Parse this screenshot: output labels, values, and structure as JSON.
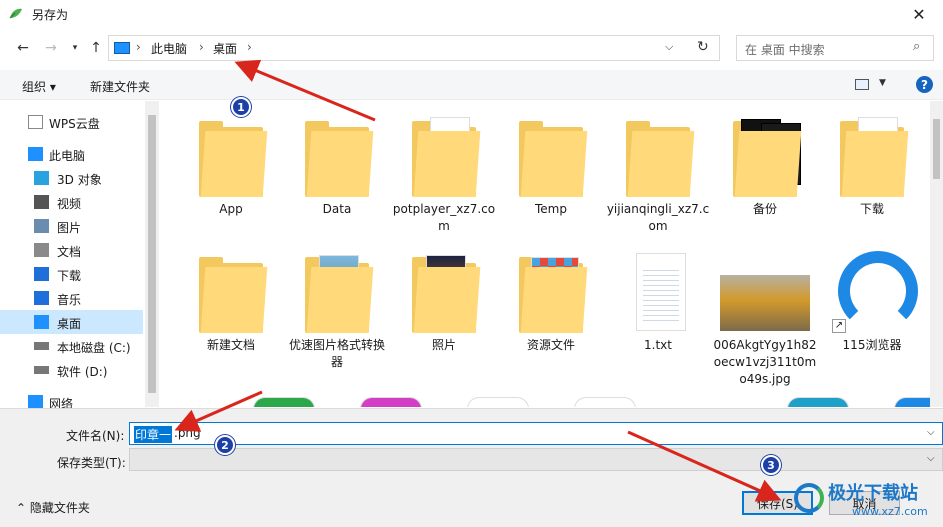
{
  "window": {
    "title": "另存为"
  },
  "nav": {
    "breadcrumbs": [
      "此电脑",
      "桌面"
    ],
    "search_placeholder": "在 桌面 中搜索"
  },
  "toolbar": {
    "organize": "组织 ▾",
    "new_folder": "新建文件夹"
  },
  "sidebar": {
    "items": [
      {
        "label": "WPS云盘",
        "icon": "cloud-doc-icon"
      },
      {
        "label": "此电脑",
        "icon": "computer-icon"
      },
      {
        "label": "3D 对象",
        "icon": "cube-3d-icon"
      },
      {
        "label": "视频",
        "icon": "video-icon"
      },
      {
        "label": "图片",
        "icon": "picture-icon"
      },
      {
        "label": "文档",
        "icon": "document-icon"
      },
      {
        "label": "下载",
        "icon": "download-icon"
      },
      {
        "label": "音乐",
        "icon": "music-icon"
      },
      {
        "label": "桌面",
        "icon": "desktop-icon"
      },
      {
        "label": "本地磁盘 (C:)",
        "icon": "drive-icon"
      },
      {
        "label": "软件 (D:)",
        "icon": "drive-icon"
      },
      {
        "label": "网络",
        "icon": "network-icon"
      }
    ]
  },
  "files": [
    {
      "name": "App",
      "kind": "folder"
    },
    {
      "name": "Data",
      "kind": "folder"
    },
    {
      "name": "potplayer_xz7.com",
      "kind": "folder-docs"
    },
    {
      "name": "Temp",
      "kind": "folder"
    },
    {
      "name": "yijianqingli_xz7.com",
      "kind": "folder"
    },
    {
      "name": "备份",
      "kind": "folder-dark"
    },
    {
      "name": "下载",
      "kind": "folder-docs"
    },
    {
      "name": "新建文档",
      "kind": "folder"
    },
    {
      "name": "优速图片格式转换器",
      "kind": "folder-photo"
    },
    {
      "name": "照片",
      "kind": "folder-fire"
    },
    {
      "name": "资源文件",
      "kind": "folder-grid"
    },
    {
      "name": "1.txt",
      "kind": "text"
    },
    {
      "name": "006AkgtYgy1h82oecw1vzj311t0mo49s.jpg",
      "kind": "image"
    },
    {
      "name": "115浏览器",
      "kind": "shortcut"
    }
  ],
  "form": {
    "filename_label": "文件名(N):",
    "filename_selected": "印章一",
    "filename_rest": ".png",
    "type_label": "保存类型(T):",
    "type_value": "",
    "hide_folders": "隐藏文件夹",
    "save_label": "保存(S)",
    "cancel_label": "取消"
  },
  "annotations": [
    "1",
    "2",
    "3"
  ],
  "watermark": {
    "text": "极光下载站",
    "url": "www.xz7.com"
  },
  "colors": {
    "accent": "#0078d7",
    "selection": "#cce8ff",
    "folder": "#ffd97a",
    "arrow": "#d9261c",
    "marker": "#1d3fa8"
  }
}
